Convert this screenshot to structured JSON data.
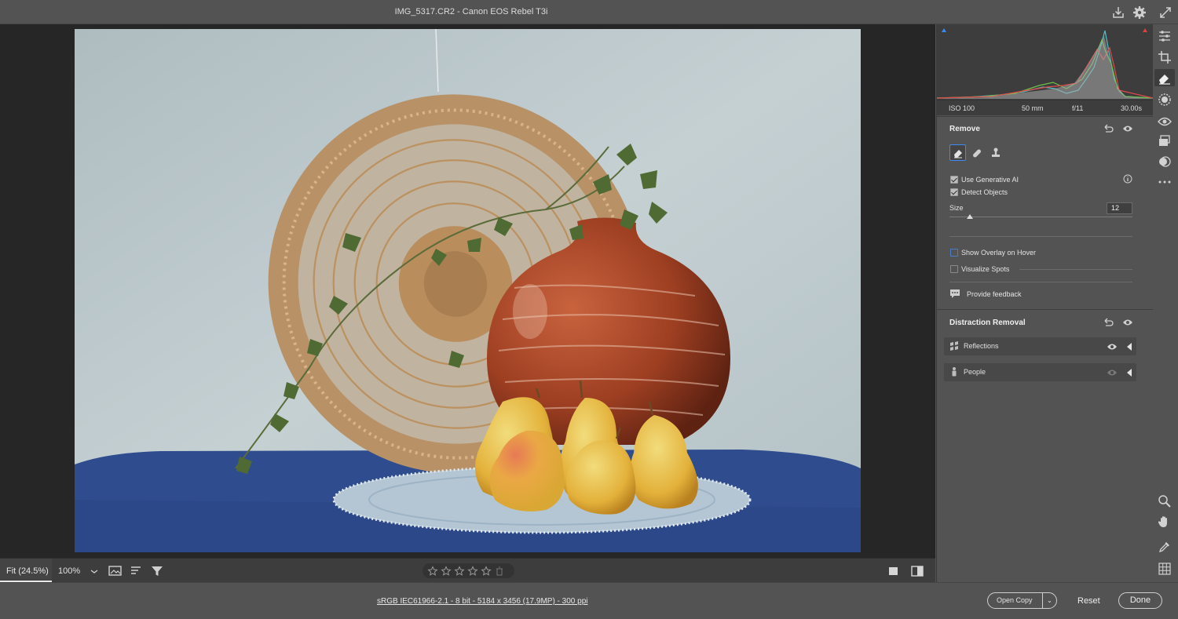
{
  "window": {
    "title": "IMG_5317.CR2  -  Canon EOS Rebel T3i"
  },
  "histogram": {
    "iso": "ISO 100",
    "focal_length": "50 mm",
    "aperture": "f/11",
    "shutter": "30.00s"
  },
  "remove_panel": {
    "title": "Remove",
    "use_generative_ai": {
      "label": "Use Generative AI",
      "checked": true
    },
    "detect_objects": {
      "label": "Detect Objects",
      "checked": true
    },
    "size_label": "Size",
    "size_value": "12",
    "show_overlay": {
      "label": "Show Overlay on Hover",
      "checked": false
    },
    "visualize_spots": {
      "label": "Visualize Spots",
      "checked": false
    },
    "feedback_label": "Provide feedback"
  },
  "distraction_panel": {
    "title": "Distraction Removal",
    "items": [
      {
        "label": "Reflections",
        "icon": "reflections-icon"
      },
      {
        "label": "People",
        "icon": "people-icon"
      }
    ]
  },
  "bottom_bar": {
    "fit_label": "Fit (24.5%)",
    "zoom_label": "100%",
    "rating_stars": 0
  },
  "status": {
    "file_info": "sRGB IEC61966-2.1 - 8 bit - 5184 x 3456 (17.9MP) - 300 ppi",
    "open_copy_label": "Open Copy",
    "reset_label": "Reset",
    "done_label": "Done"
  },
  "colors": {
    "accent": "#3e8af2",
    "panel_bg": "#535353",
    "canvas_bg": "#262626"
  }
}
